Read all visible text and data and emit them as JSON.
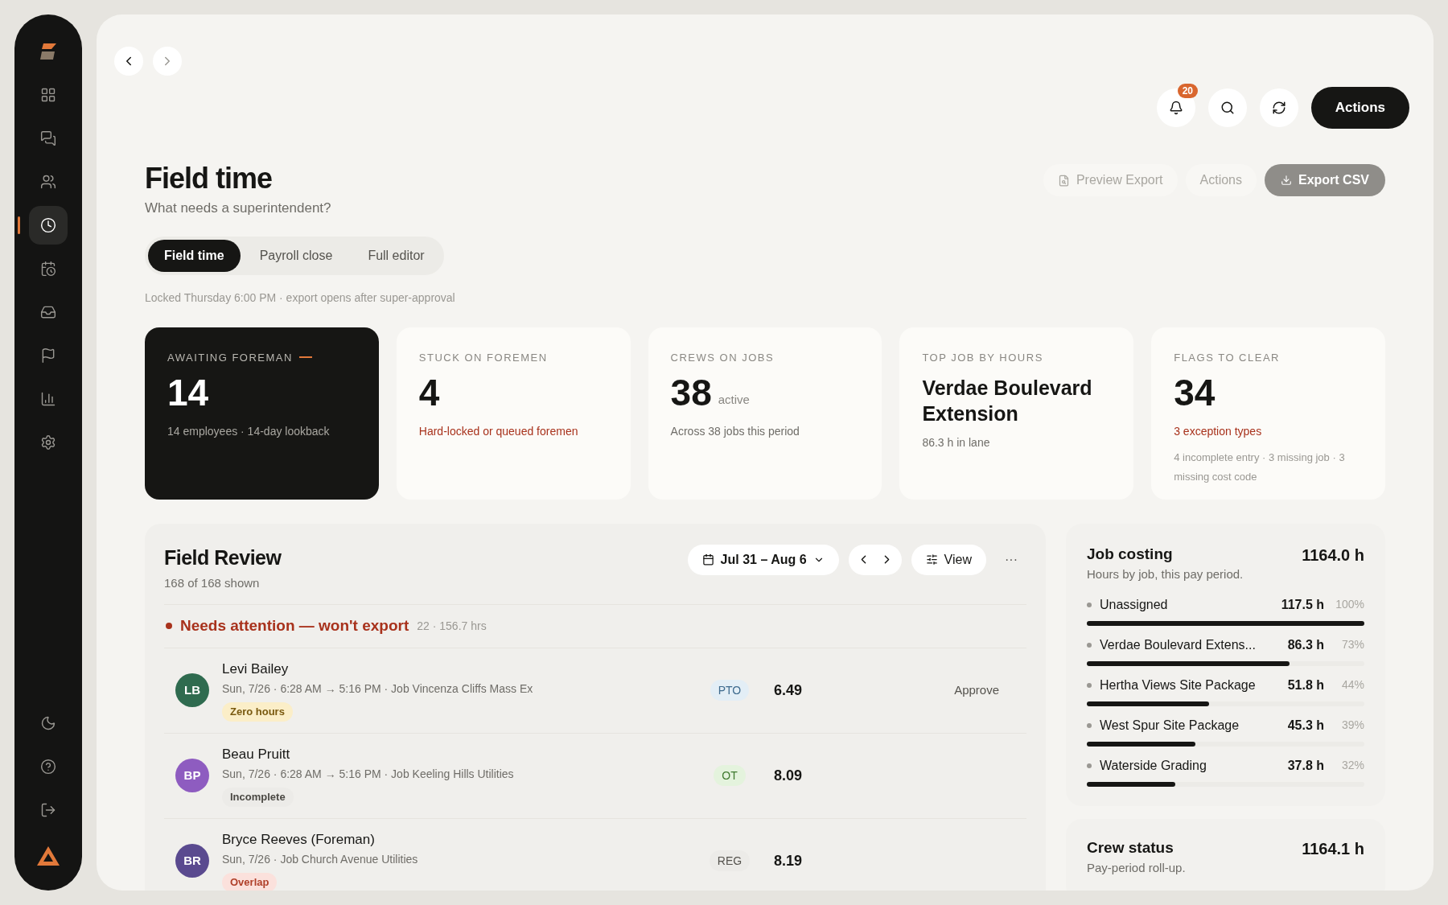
{
  "sidebar": {
    "items": [
      {
        "selected": false
      },
      {
        "selected": false
      },
      {
        "selected": false
      },
      {
        "selected": true
      },
      {
        "selected": false
      },
      {
        "selected": false
      },
      {
        "selected": false
      },
      {
        "selected": false
      },
      {
        "selected": false
      }
    ],
    "bottom_items": [
      {
        "selected": false
      },
      {
        "selected": false
      },
      {
        "selected": false
      }
    ]
  },
  "topbar": {
    "notification_count": "20",
    "primary_button": "Actions"
  },
  "header": {
    "title": "Field time",
    "subtitle": "What needs a superintendent?",
    "buttons": [
      {
        "label": "Preview Export",
        "kind": "ghost-icon"
      },
      {
        "label": "Actions",
        "kind": "ghost"
      },
      {
        "label": "Export CSV",
        "kind": "filled"
      }
    ]
  },
  "tabs": [
    {
      "label": "Field time",
      "selected": true
    },
    {
      "label": "Payroll close",
      "selected": false
    },
    {
      "label": "Full editor",
      "selected": false
    }
  ],
  "lock_note": "Locked Thursday 6:00 PM · export opens after super-approval",
  "cards": [
    {
      "label": "AWAITING FOREMAN",
      "selected": true,
      "kind": "number",
      "value": "14",
      "note": "14 employees · 14-day lookback",
      "alert": false
    },
    {
      "label": "STUCK ON FOREMEN",
      "selected": false,
      "kind": "number",
      "value": "4",
      "note": "Hard-locked or queued foremen",
      "alert": true
    },
    {
      "label": "CREWS ON JOBS",
      "selected": false,
      "kind": "number",
      "value": "38",
      "suffix": "active",
      "note": "Across 38 jobs this period",
      "alert": false
    },
    {
      "label": "TOP JOB BY HOURS",
      "selected": false,
      "kind": "title",
      "value": "Verdae Boulevard Extension",
      "note": "86.3 h in lane",
      "alert": false
    },
    {
      "label": "FLAGS TO CLEAR",
      "selected": false,
      "kind": "number",
      "value": "34",
      "note": "3 exception types",
      "alert": true,
      "detail": "4 incomplete entry · 3 missing job · 3 missing cost code"
    }
  ],
  "review": {
    "title": "Field Review",
    "count": "168 of 168 shown",
    "date_range": "Jul 31 – Aug 6",
    "view_button": "View",
    "more": "···",
    "group": {
      "title": "Needs attention — won't export",
      "meta": "22 · 156.7 hrs"
    },
    "rows": [
      {
        "initials": "LB",
        "color": "#2f6b4f",
        "name": "Levi Bailey",
        "detail": "Sun, 7/26 · 6:28 AM → 5:16 PM · Job Vincenza Cliffs Mass Ex",
        "flag": {
          "label": "Zero hours",
          "kind": "warning"
        },
        "type": {
          "label": "PTO",
          "kind": "pto"
        },
        "hours": "6.49",
        "action": "Approve"
      },
      {
        "initials": "BP",
        "color": "#8e5cc0",
        "name": "Beau Pruitt",
        "detail": "Sun, 7/26 · 6:28 AM → 5:16 PM · Job Keeling Hills Utilities",
        "flag": {
          "label": "Incomplete",
          "kind": "neutral"
        },
        "type": {
          "label": "OT",
          "kind": "ot"
        },
        "hours": "8.09"
      },
      {
        "initials": "BR",
        "color": "#5a4a8f",
        "name": "Bryce Reeves (Foreman)",
        "detail": "Sun, 7/26 · Job Church Avenue Utilities",
        "flag": {
          "label": "Overlap",
          "kind": "danger"
        },
        "type": {
          "label": "REG",
          "kind": "reg"
        },
        "hours": "8.19"
      }
    ]
  },
  "job_costing": {
    "title": "Job costing",
    "subtitle": "Hours by job, this pay period.",
    "total": "1164.0 h",
    "items": [
      {
        "name": "Unassigned",
        "hours": "117.5 h",
        "percent": "100%",
        "level": 1
      },
      {
        "name": "Verdae Boulevard Extens...",
        "hours": "86.3 h",
        "percent": "73%",
        "level": 0.73
      },
      {
        "name": "Hertha Views Site Package",
        "hours": "51.8 h",
        "percent": "44%",
        "level": 0.44
      },
      {
        "name": "West Spur Site Package",
        "hours": "45.3 h",
        "percent": "39%",
        "level": 0.39
      },
      {
        "name": "Waterside Grading",
        "hours": "37.8 h",
        "percent": "32%",
        "level": 0.32
      }
    ]
  },
  "crew_status": {
    "title": "Crew status",
    "subtitle": "Pay-period roll-up.",
    "total": "1164.1 h"
  }
}
